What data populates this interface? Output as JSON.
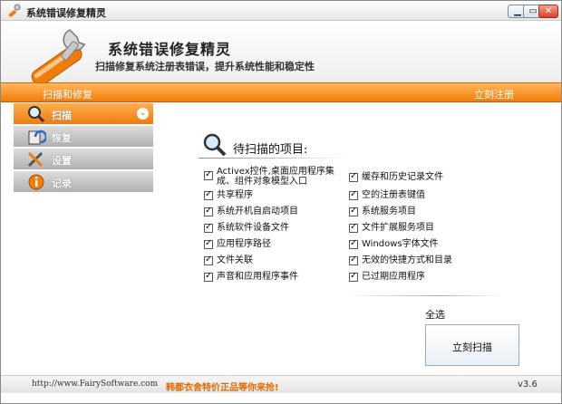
{
  "window": {
    "title": "系统错误修复精灵",
    "buttons": {
      "minimize": "▁",
      "maximize": "▭",
      "close": "✕"
    }
  },
  "header": {
    "app_name": "系统错误修复精灵",
    "subtitle": "扫描修复系统注册表错误，提升系统性能和稳定性"
  },
  "toolbar": {
    "left_label": "扫描和修复",
    "register_label": "立刻注册"
  },
  "sidebar": {
    "items": [
      {
        "label": "扫描",
        "icon": "magnifier-icon",
        "active": true
      },
      {
        "label": "恢复",
        "icon": "restore-icon",
        "active": false
      },
      {
        "label": "设置",
        "icon": "tools-icon",
        "active": false
      },
      {
        "label": "记录",
        "icon": "info-icon",
        "active": false
      }
    ],
    "expand_glyph": "⌄"
  },
  "main": {
    "scan_title": "待扫描的项目:",
    "left_items": [
      "Activex控件,桌面应用程序集成、组件对象模型入口",
      "共享程序",
      "系统开机自启动项目",
      "系统软件设备文件",
      "应用程序路径",
      "文件关联",
      "声音和应用程序事件"
    ],
    "right_items": [
      "缓存和历史记录文件",
      "空的注册表键值",
      "系统服务项目",
      "文件扩展服务项目",
      "Windows字体文件",
      "无效的快捷方式和目录",
      "已过期应用程序"
    ],
    "select_all": "全选",
    "scan_button": "立刻扫描"
  },
  "status": {
    "url": "http://www.FairySoftware.com",
    "promo": "韩都衣舍特价正品等你来抢!",
    "version": "v3.6"
  },
  "colors": {
    "accent": "#f07c0a",
    "accent_light": "#ffb75a",
    "promo": "#e36a00",
    "nav_gray": "#b0b0b0"
  }
}
